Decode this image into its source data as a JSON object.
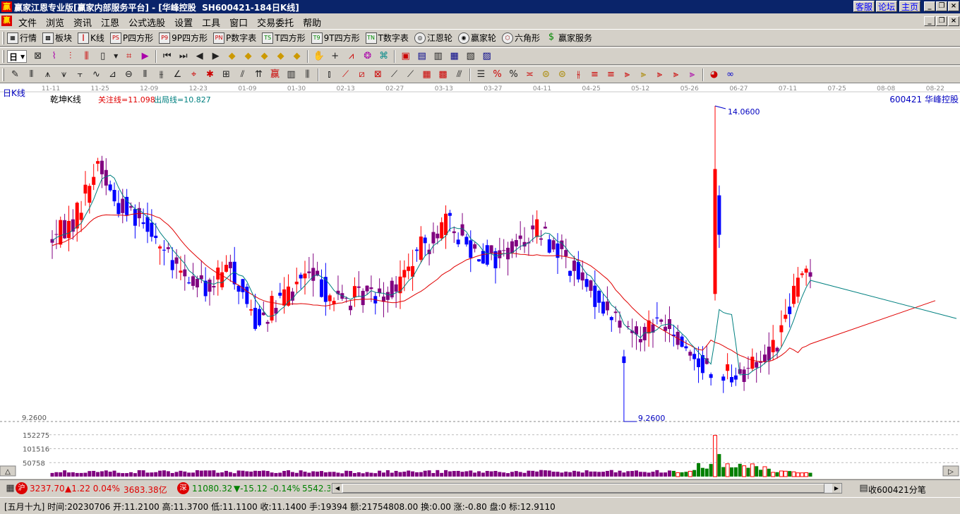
{
  "window": {
    "title": "赢家江恩专业版[赢家内部服务平台] - [华峰控股  SH600421-184日K线]",
    "links": [
      "客服",
      "论坛",
      "主页"
    ]
  },
  "menu": {
    "items": [
      "文件",
      "浏览",
      "资讯",
      "江恩",
      "公式选股",
      "设置",
      "工具",
      "窗口",
      "交易委托",
      "帮助"
    ]
  },
  "toolbar1": {
    "items": [
      {
        "icon": "grid-icon",
        "label": "行情"
      },
      {
        "icon": "blocks-icon",
        "label": "板块"
      },
      {
        "icon": "kline-icon",
        "label": "K线"
      },
      {
        "icon": "ps-icon",
        "label": "P四方形"
      },
      {
        "icon": "p9-icon",
        "label": "9P四方形"
      },
      {
        "icon": "pn-icon",
        "label": "P数字表"
      },
      {
        "icon": "ts-icon",
        "label": "T四方形"
      },
      {
        "icon": "t9-icon",
        "label": "9T四方形"
      },
      {
        "icon": "tn-icon",
        "label": "T数字表"
      },
      {
        "icon": "wheel-icon",
        "label": "江恩轮"
      },
      {
        "icon": "wheel2-icon",
        "label": "赢家轮"
      },
      {
        "icon": "hexagon-icon",
        "label": "六角形"
      },
      {
        "icon": "dollar-icon",
        "label": "赢家服务"
      }
    ]
  },
  "period": {
    "value": "日"
  },
  "chart": {
    "period_label": "日K线",
    "indicator_name": "乾坤K线",
    "attention_line": "关注线=11.098",
    "exit_line": "出局线=10.827",
    "stock_label": "600421 华峰控股",
    "high_label": "14.0600",
    "low_label": "9.2600",
    "vol_axis_top": "9.2600",
    "vol_ticks": [
      "152275",
      "101516",
      "50758"
    ],
    "date_labels": [
      "11-11",
      "11-25",
      "12-09",
      "12-23",
      "01-09",
      "01-30",
      "02-13",
      "02-27",
      "03-13",
      "03-27",
      "04-11",
      "04-25",
      "05-12",
      "05-26",
      "06-27",
      "07-11",
      "07-25",
      "08-08",
      "08-22"
    ]
  },
  "chart_data": {
    "type": "candlestick",
    "price_range": [
      9.26,
      14.06
    ],
    "high": 14.06,
    "low": 9.26,
    "series": [
      {
        "name": "关注线",
        "last_value": 11.098,
        "color": "#e00000"
      },
      {
        "name": "出局线",
        "last_value": 10.827,
        "color": "#008080"
      }
    ],
    "volume_ticks": [
      152275,
      101516,
      50758
    ]
  },
  "status": {
    "sh_badge": "沪",
    "sh_index": "3237.70",
    "sh_change": "▲1.22 0.04%",
    "sh_amount": "3683.38亿",
    "sz_badge": "深",
    "sz_index": "11080.32",
    "sz_change": "▼-15.12 -0.14%",
    "sz_amount": "5542.3",
    "ticker_label": "收600421分笔"
  },
  "info": {
    "text": "[五月十九] 时间:20230706 开:11.2100 高:11.3700 低:11.1100 收:11.1400 手:19394 额:21754808.00 换:0.00 涨:-0.80 盘:0 标:12.9110"
  },
  "colors": {
    "up": "#ff0000",
    "down": "#0000ff",
    "neutral": "#800080",
    "titlebar": "#0a246a"
  }
}
